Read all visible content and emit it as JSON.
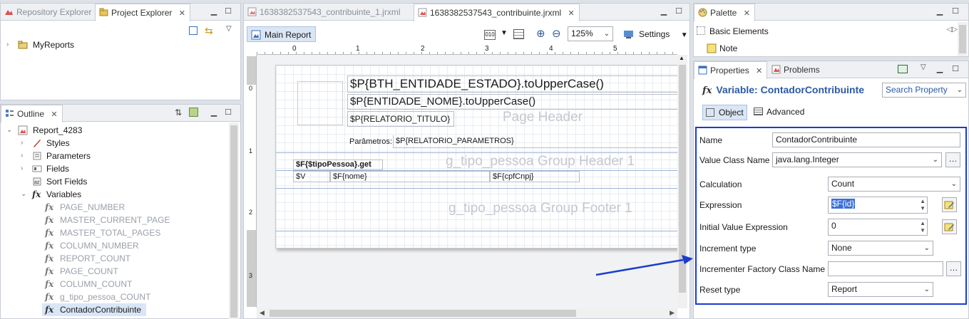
{
  "left_top": {
    "tabs": [
      {
        "label": "Repository Explorer"
      },
      {
        "label": "Project Explorer"
      }
    ],
    "tree": [
      {
        "label": "MyReports"
      }
    ]
  },
  "outline": {
    "title": "Outline",
    "report": "Report_4283",
    "nodes": [
      "Styles",
      "Parameters",
      "Fields",
      "Sort Fields",
      "Variables"
    ],
    "variables": [
      "PAGE_NUMBER",
      "MASTER_CURRENT_PAGE",
      "MASTER_TOTAL_PAGES",
      "COLUMN_NUMBER",
      "REPORT_COUNT",
      "PAGE_COUNT",
      "COLUMN_COUNT",
      "g_tipo_pessoa_COUNT",
      "ContadorContribuinte"
    ]
  },
  "editor": {
    "tabs": [
      {
        "label": "1638382537543_contribuinte_1.jrxml"
      },
      {
        "label": "1638382537543_contribuinte.jrxml"
      }
    ],
    "main_report": "Main Report",
    "zoom": "125%",
    "settings": "Settings",
    "ruler_numbers": [
      "0",
      "1",
      "2",
      "3",
      "4",
      "5"
    ],
    "vruler_numbers": [
      "0",
      "1",
      "2",
      "3"
    ],
    "report": {
      "header_line1": "$P{BTH_ENTIDADE_ESTADO}.toUpperCase()",
      "header_line2": "$P{ENTIDADE_NOME}.toUpperCase()",
      "header_line3": "$P{RELATORIO_TITULO}",
      "params_label": "Parâmetros:",
      "params_value": "$P{RELATORIO_PARAMETROS}",
      "band_page_header": "Page Header",
      "group_field": "$F{$tipoPessoa}.get",
      "col_v": "$V",
      "col_nome": "$F{nome}",
      "col_cpf": "$F{cpfCnpj}",
      "band_group_header": "g_tipo_pessoa Group Header 1",
      "band_group_footer": "g_tipo_pessoa Group Footer 1"
    }
  },
  "palette": {
    "title": "Palette",
    "section": "Basic Elements",
    "items": [
      "Note"
    ]
  },
  "properties": {
    "tabs": [
      {
        "label": "Properties"
      },
      {
        "label": "Problems"
      }
    ],
    "heading": "Variable: ContadorContribuinte",
    "search_placeholder": "Search Property",
    "subtabs": [
      "Object",
      "Advanced"
    ],
    "fields": {
      "name_label": "Name",
      "name_value": "ContadorContribuinte",
      "value_class_label": "Value Class Name",
      "value_class_value": "java.lang.Integer",
      "calculation_label": "Calculation",
      "calculation_value": "Count",
      "expression_label": "Expression",
      "expression_value": "$F{id}",
      "initial_label": "Initial Value Expression",
      "initial_value": "0",
      "increment_type_label": "Increment type",
      "increment_type_value": "None",
      "incrementer_label": "Incrementer Factory Class Name",
      "incrementer_value": "",
      "reset_type_label": "Reset type",
      "reset_type_value": "Report"
    }
  },
  "colors": {
    "highlight_border": "#1a3ccf",
    "arrow": "#1a3ccf",
    "selection": "#3b6fd6"
  }
}
